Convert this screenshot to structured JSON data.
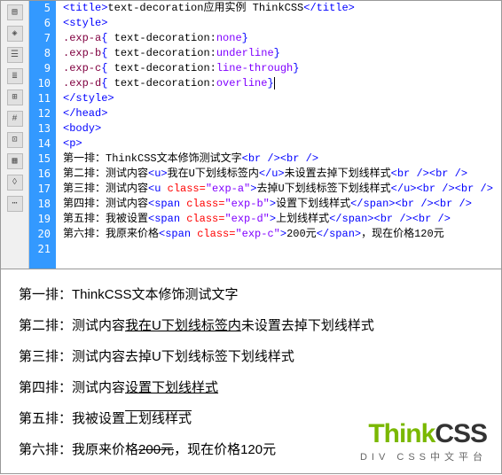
{
  "line_numbers": [
    "5",
    "6",
    "7",
    "8",
    "9",
    "10",
    "11",
    "12",
    "13",
    "14",
    "15",
    "16",
    "17",
    "18",
    "19",
    "20",
    "21"
  ],
  "code": {
    "l5": {
      "title_text": "text-decoration应用实例 ThinkCSS"
    },
    "l7": {
      "sel": ".exp-a",
      "val": "none"
    },
    "l8": {
      "sel": ".exp-b",
      "val": "underline"
    },
    "l9": {
      "sel": ".exp-c",
      "val": "line-through"
    },
    "l10": {
      "sel": ".exp-d",
      "val": "overline"
    },
    "l15": {
      "t1": "第一排：ThinkCSS文本修饰测试文字"
    },
    "l16": {
      "t1": "第二排：测试内容",
      "t2": "我在U下划线标签内",
      "t3": "未设置去掉下划线样式"
    },
    "l17": {
      "t1": "第三排：测试内容",
      "cls": "\"exp-a\"",
      "t2": "去掉U下划线标签下划线样式"
    },
    "l18": {
      "t1": "第四排：测试内容",
      "cls": "\"exp-b\"",
      "t2": "设置下划线样式"
    },
    "l19": {
      "t1": "第五排：我被设置",
      "cls": "\"exp-d\"",
      "t2": "上划线样式"
    },
    "l20": {
      "t1": "第六排：我原来价格",
      "cls": "\"exp-c\"",
      "t2": "200元",
      "t3": "，现在价格120元"
    }
  },
  "preview": {
    "row1_label": "第一排：",
    "row1_text": "ThinkCSS文本修饰测试文字",
    "row2_label": "第二排：",
    "row2_a": "测试内容",
    "row2_u": "我在U下划线标签内",
    "row2_b": "未设置去掉下划线样式",
    "row3_label": "第三排：",
    "row3_a": "测试内容",
    "row3_u": "去掉U下划线标签下划线样式",
    "row4_label": "第四排：",
    "row4_a": "测试内容",
    "row4_s": "设置下划线样式",
    "row5_label": "第五排：",
    "row5_a": "我被设置",
    "row5_s": "上划线样式",
    "row6_label": "第六排：",
    "row6_a": "我原来价格",
    "row6_s": "200元",
    "row6_b": "，现在价格120元"
  },
  "logo": {
    "main_a": "Think",
    "main_b": "CSS",
    "sub": "DIV CSS中文平台"
  },
  "tags": {
    "title_o": "<title>",
    "title_c": "</title>",
    "style_o": "<style>",
    "style_c": "</style>",
    "head_c": "</head>",
    "body_o": "<body>",
    "p_o": "<p>",
    "u_o": "<u>",
    "u_c": "</u>",
    "u_cls_o": "<u ",
    "span_cls_o": "<span ",
    "span_c": "</span>",
    "br": "<br />",
    "class_eq": "class=",
    "gt": ">",
    "brace_o": "{ ",
    "brace_c": "}",
    "td": "text-decoration:"
  }
}
